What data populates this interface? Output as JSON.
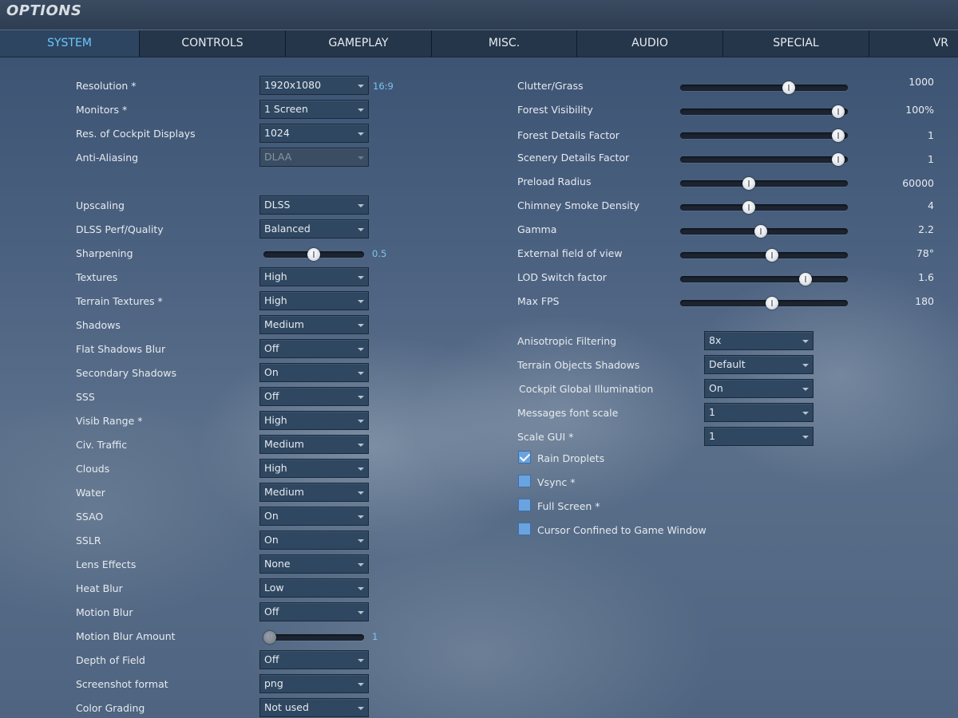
{
  "window": {
    "title": "OPTIONS"
  },
  "tabs": [
    "SYSTEM",
    "CONTROLS",
    "GAMEPLAY",
    "MISC.",
    "AUDIO",
    "SPECIAL",
    "VR"
  ],
  "active_tab": "SYSTEM",
  "left": {
    "resolution": {
      "label": "Resolution *",
      "value": "1920x1080",
      "aspect": "16:9"
    },
    "monitors": {
      "label": "Monitors *",
      "value": "1 Screen"
    },
    "res_cockpit": {
      "label": "Res. of Cockpit Displays",
      "value": "1024"
    },
    "anti_aliasing": {
      "label": "Anti-Aliasing",
      "value": "DLAA",
      "disabled": true
    },
    "upscaling": {
      "label": "Upscaling",
      "value": "DLSS"
    },
    "dlss_quality": {
      "label": "DLSS Perf/Quality",
      "value": "Balanced"
    },
    "sharpening": {
      "label": "Sharpening",
      "value": "0.5",
      "level": 0.5
    },
    "textures": {
      "label": "Textures",
      "value": "High"
    },
    "terrain_textures": {
      "label": "Terrain Textures *",
      "value": "High"
    },
    "shadows": {
      "label": "Shadows",
      "value": "Medium"
    },
    "flat_shadows_blur": {
      "label": "Flat Shadows Blur",
      "value": "Off"
    },
    "secondary_shadows": {
      "label": "Secondary Shadows",
      "value": "On"
    },
    "sss": {
      "label": "SSS",
      "value": "Off"
    },
    "visib_range": {
      "label": "Visib Range *",
      "value": "High"
    },
    "civ_traffic": {
      "label": "Civ. Traffic",
      "value": "Medium"
    },
    "clouds": {
      "label": "Clouds",
      "value": "High"
    },
    "water": {
      "label": "Water",
      "value": "Medium"
    },
    "ssao": {
      "label": "SSAO",
      "value": "On"
    },
    "sslr": {
      "label": "SSLR",
      "value": "On"
    },
    "lens_effects": {
      "label": "Lens Effects",
      "value": "None"
    },
    "heat_blur": {
      "label": "Heat Blur",
      "value": "Low"
    },
    "motion_blur": {
      "label": "Motion Blur",
      "value": "Off"
    },
    "motion_blur_amount": {
      "label": "Motion Blur Amount",
      "value": "1",
      "level": 0.0,
      "disabled": true
    },
    "depth_of_field": {
      "label": "Depth of Field",
      "value": "Off"
    },
    "screenshot_format": {
      "label": "Screenshot format",
      "value": "png"
    },
    "color_grading": {
      "label": "Color Grading",
      "value": "Not used"
    }
  },
  "right": {
    "sliders": [
      {
        "label": "Clutter/Grass",
        "value": "1000",
        "level": 0.66
      },
      {
        "label": "Forest Visibility",
        "value": "100%",
        "level": 0.98
      },
      {
        "label": "Forest Details Factor",
        "value": "1",
        "level": 0.98
      },
      {
        "label": "Scenery Details Factor",
        "value": "1",
        "level": 0.98
      },
      {
        "label": "Preload Radius",
        "value": "60000",
        "level": 0.4
      },
      {
        "label": "Chimney Smoke Density",
        "value": "4",
        "level": 0.4
      },
      {
        "label": "Gamma",
        "value": "2.2",
        "level": 0.48
      },
      {
        "label": "External field of view",
        "value": "78°",
        "level": 0.55
      },
      {
        "label": "LOD Switch factor",
        "value": "1.6",
        "level": 0.77
      },
      {
        "label": "Max FPS",
        "value": "180",
        "level": 0.55
      }
    ],
    "dropdowns": [
      {
        "label": "Anisotropic Filtering",
        "value": "8x"
      },
      {
        "label": "Terrain Objects Shadows",
        "value": "Default"
      },
      {
        "label": "Cockpit Global Illumination",
        "value": "On"
      },
      {
        "label": "Messages font scale",
        "value": "1"
      },
      {
        "label": "Scale GUI *",
        "value": "1"
      }
    ],
    "checkboxes": [
      {
        "label": "Rain Droplets",
        "checked": true
      },
      {
        "label": "Vsync *",
        "checked": false
      },
      {
        "label": "Full Screen *",
        "checked": false
      },
      {
        "label": "Cursor Confined to Game Window",
        "checked": false
      }
    ]
  }
}
